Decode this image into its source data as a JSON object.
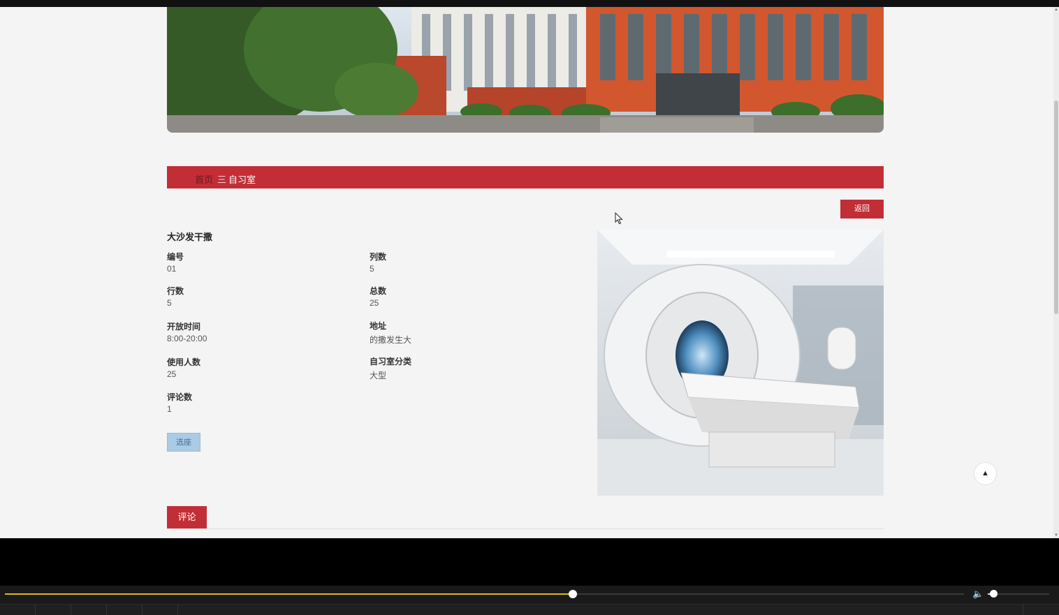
{
  "breadcrumb": {
    "home": "首页",
    "separator": "三",
    "current": "自习室"
  },
  "back_label": "返回",
  "room": {
    "name": "大沙发干撒",
    "fields": [
      {
        "label": "编号",
        "value": "01"
      },
      {
        "label": "列数",
        "value": "5"
      },
      {
        "label": "行数",
        "value": "5"
      },
      {
        "label": "总数",
        "value": "25"
      },
      {
        "label": "开放时间",
        "value": "8:00-20:00"
      },
      {
        "label": "地址",
        "value": "的撒发生大"
      },
      {
        "label": "使用人数",
        "value": "25"
      },
      {
        "label": "自习室分类",
        "value": "大型"
      },
      {
        "label": "评论数",
        "value": "1"
      }
    ]
  },
  "seat_button_label": "选座",
  "comment_tab_label": "评论",
  "player": {
    "progress_fraction": 0.592,
    "volume_fraction": 0.09
  },
  "colors": {
    "accent": "#c22e36",
    "seat_button": "#a9cbe6",
    "progress": "#e5b81a"
  }
}
